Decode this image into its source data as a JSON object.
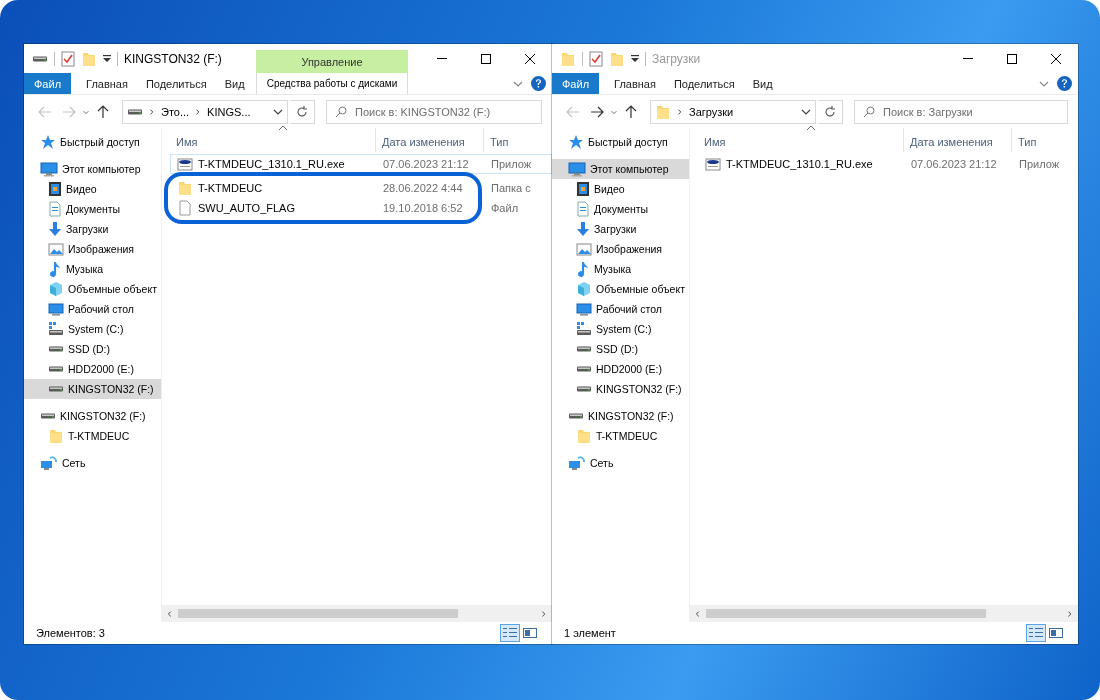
{
  "windows": [
    {
      "title": "KINGSTON32 (F:)",
      "active": true,
      "kind": "drive",
      "ribbon_tabs": [
        {
          "label": "Файл",
          "kind": "file"
        },
        {
          "label": "Главная",
          "kind": "tab"
        },
        {
          "label": "Поделиться",
          "kind": "tab"
        },
        {
          "label": "Вид",
          "kind": "tab"
        }
      ],
      "contextual_tab": {
        "group": "Управление",
        "label": "Средства работы с дисками"
      },
      "back_enabled": false,
      "forward_enabled": false,
      "address": {
        "kind": "drive",
        "segments": [
          "Это...",
          "KINGS..."
        ]
      },
      "search": {
        "placeholder": "Поиск в: KINGSTON32 (F:)"
      },
      "sidebar": [
        {
          "label": "Быстрый доступ",
          "kind": "star",
          "selected": false
        },
        {
          "label": "Этот компьютер",
          "kind": "pc",
          "selected": false,
          "children": [
            {
              "label": "Видео",
              "kind": "video",
              "selected": false
            },
            {
              "label": "Документы",
              "kind": "docs",
              "selected": false
            },
            {
              "label": "Загрузки",
              "kind": "download",
              "selected": false
            },
            {
              "label": "Изображения",
              "kind": "images",
              "selected": false
            },
            {
              "label": "Музыка",
              "kind": "music",
              "selected": false
            },
            {
              "label": "Объемные объект",
              "kind": "cube",
              "selected": false
            },
            {
              "label": "Рабочий стол",
              "kind": "desktop",
              "selected": false
            },
            {
              "label": "System (C:)",
              "kind": "system",
              "selected": false
            },
            {
              "label": "SSD (D:)",
              "kind": "drive",
              "selected": false
            },
            {
              "label": "HDD2000 (E:)",
              "kind": "drive",
              "selected": false
            },
            {
              "label": "KINGSTON32 (F:)",
              "kind": "drive",
              "selected": true
            }
          ]
        },
        {
          "label": "KINGSTON32 (F:)",
          "kind": "drive",
          "selected": false,
          "children": [
            {
              "label": "T-KTMDEUC",
              "kind": "folder",
              "selected": false
            }
          ]
        },
        {
          "label": "Сеть",
          "kind": "network",
          "selected": false
        }
      ],
      "columns": [
        {
          "label": "Имя",
          "sorted": true
        },
        {
          "label": "Дата изменения",
          "sorted": false
        },
        {
          "label": "Тип",
          "sorted": false
        }
      ],
      "rows": [
        {
          "kind": "exe",
          "name": "T-KTMDEUC_1310.1_RU.exe",
          "date": "07.06.2023 21:12",
          "type": "Прилож",
          "focused": true,
          "highlighted": false
        },
        {
          "kind": "folder",
          "name": "T-KTMDEUC",
          "date": "28.06.2022 4:44",
          "type": "Папка с",
          "focused": false,
          "highlighted": true
        },
        {
          "kind": "file",
          "name": "SWU_AUTO_FLAG",
          "date": "19.10.2018 6:52",
          "type": "Файл",
          "focused": false,
          "highlighted": true
        }
      ],
      "status": "Элементов: 3",
      "view_buttons": [
        {
          "kind": "details",
          "selected": true
        },
        {
          "kind": "tiles",
          "selected": false
        }
      ]
    },
    {
      "title": "Загрузки",
      "active": false,
      "kind": "folder",
      "ribbon_tabs": [
        {
          "label": "Файл",
          "kind": "file"
        },
        {
          "label": "Главная",
          "kind": "tab"
        },
        {
          "label": "Поделиться",
          "kind": "tab"
        },
        {
          "label": "Вид",
          "kind": "tab"
        }
      ],
      "back_enabled": false,
      "forward_enabled": true,
      "address": {
        "kind": "folder",
        "segments": [
          "Загрузки"
        ]
      },
      "search": {
        "placeholder": "Поиск в: Загрузки"
      },
      "sidebar": [
        {
          "label": "Быстрый доступ",
          "kind": "star",
          "selected": false
        },
        {
          "label": "Этот компьютер",
          "kind": "pc",
          "selected": true,
          "children": [
            {
              "label": "Видео",
              "kind": "video",
              "selected": false
            },
            {
              "label": "Документы",
              "kind": "docs",
              "selected": false
            },
            {
              "label": "Загрузки",
              "kind": "download",
              "selected": false
            },
            {
              "label": "Изображения",
              "kind": "images",
              "selected": false
            },
            {
              "label": "Музыка",
              "kind": "music",
              "selected": false
            },
            {
              "label": "Объемные объект",
              "kind": "cube",
              "selected": false
            },
            {
              "label": "Рабочий стол",
              "kind": "desktop",
              "selected": false
            },
            {
              "label": "System (C:)",
              "kind": "system",
              "selected": false
            },
            {
              "label": "SSD (D:)",
              "kind": "drive",
              "selected": false
            },
            {
              "label": "HDD2000 (E:)",
              "kind": "drive",
              "selected": false
            },
            {
              "label": "KINGSTON32 (F:)",
              "kind": "drive",
              "selected": false
            }
          ]
        },
        {
          "label": "KINGSTON32 (F:)",
          "kind": "drive",
          "selected": false,
          "children": [
            {
              "label": "T-KTMDEUC",
              "kind": "folder",
              "selected": false
            }
          ]
        },
        {
          "label": "Сеть",
          "kind": "network",
          "selected": false
        }
      ],
      "columns": [
        {
          "label": "Имя",
          "sorted": true
        },
        {
          "label": "Дата изменения",
          "sorted": false
        },
        {
          "label": "Тип",
          "sorted": false
        }
      ],
      "rows": [
        {
          "kind": "exe",
          "name": "T-KTMDEUC_1310.1_RU.exe",
          "date": "07.06.2023 21:12",
          "type": "Прилож",
          "focused": false,
          "highlighted": false
        }
      ],
      "status": "1 элемент",
      "view_buttons": [
        {
          "kind": "details",
          "selected": true
        },
        {
          "kind": "tiles",
          "selected": false
        }
      ]
    }
  ]
}
